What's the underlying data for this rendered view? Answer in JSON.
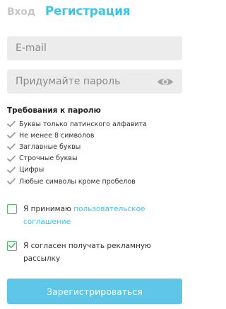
{
  "colors": {
    "accent": "#3ec4e6",
    "button": "#5fc6e7",
    "checkbox": "#4dbd61",
    "field_bg": "#ececec",
    "inactive_tab": "#c7c7c7"
  },
  "tabs": {
    "login": "Вход",
    "register": "Регистрация",
    "active": "register"
  },
  "form": {
    "email": {
      "placeholder": "E-mail",
      "value": ""
    },
    "password": {
      "placeholder": "Придумайте пароль",
      "value": "",
      "toggle_icon": "eye-icon"
    }
  },
  "requirements": {
    "title": "Требования к паролю",
    "icon": "check-icon",
    "items": [
      "Буквы только латинского алфавита",
      "Не менее 8 символов",
      "Заглавные буквы",
      "Строчные буквы",
      "Цифры",
      "Любые символы кроме пробелов"
    ]
  },
  "consents": {
    "agreement": {
      "checked": false,
      "text_before": "Я принимаю ",
      "link_text": "пользовательское соглашение"
    },
    "ads": {
      "checked": true,
      "text": "Я согласен получать рекламную рассылку"
    }
  },
  "submit_label": "Зарегистрироваться"
}
